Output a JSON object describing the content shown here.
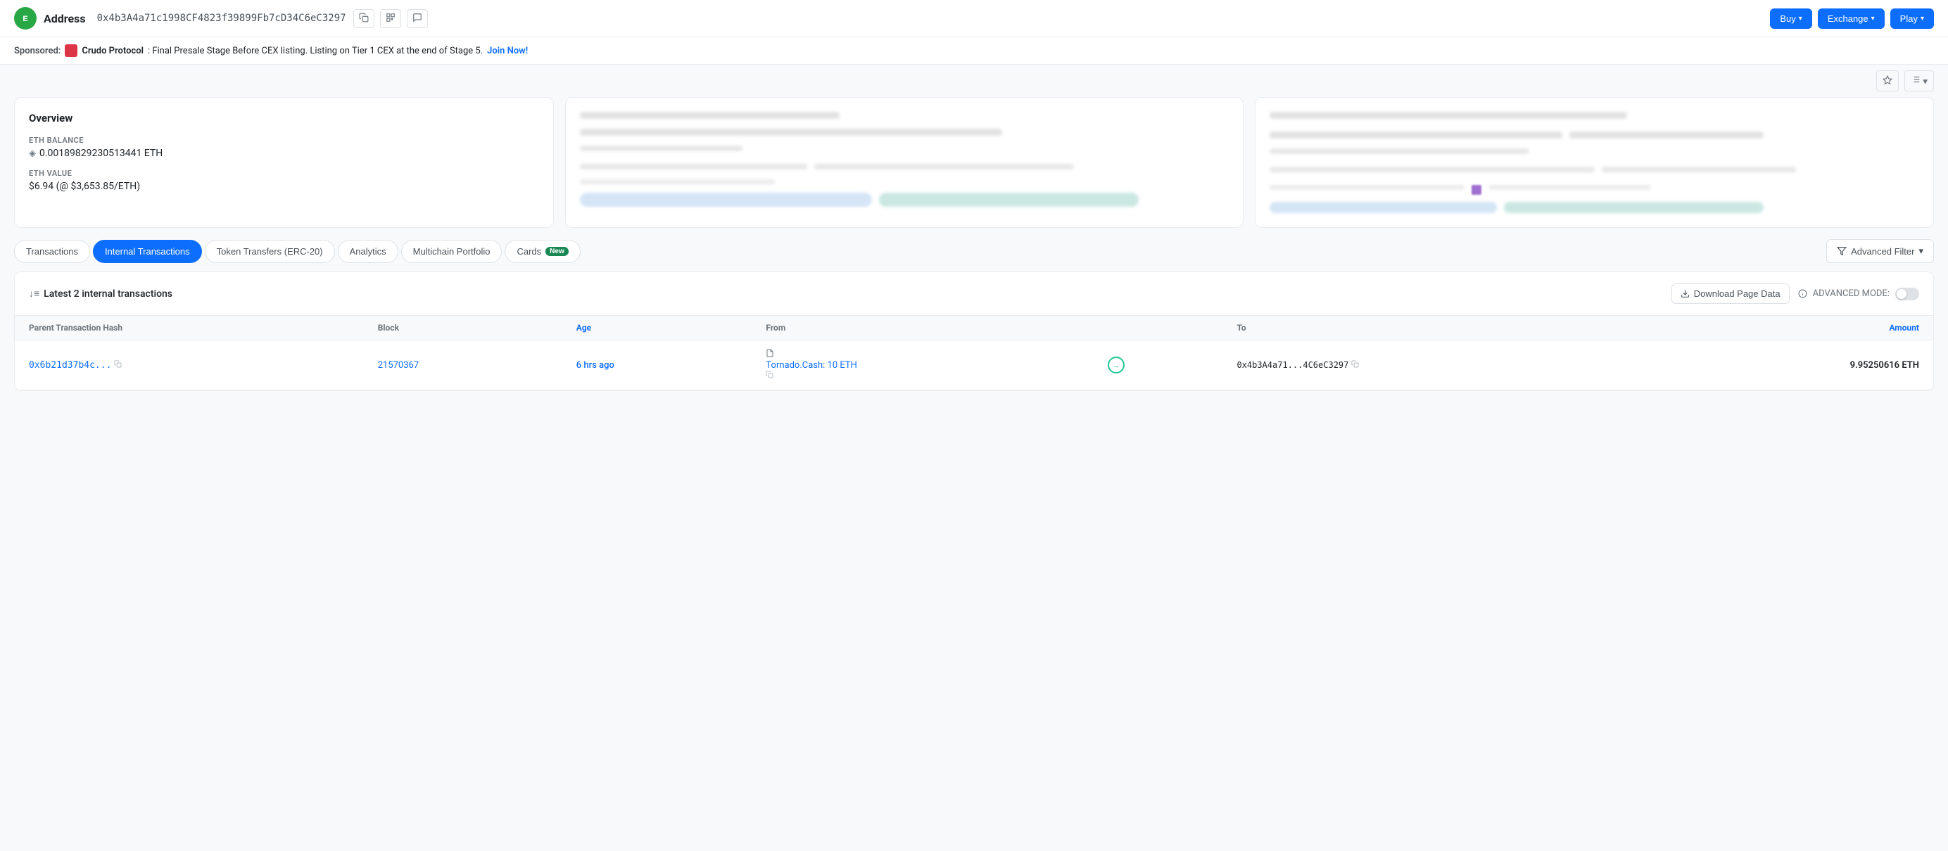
{
  "header": {
    "logo_text": "E",
    "address_label": "Address",
    "address_value": "0x4b3A4a71c1998CF4823f39899Fb7cD34C6eC3297",
    "icons": [
      "copy",
      "qr",
      "chat"
    ],
    "buttons": [
      {
        "label": "Buy",
        "key": "buy"
      },
      {
        "label": "Exchange",
        "key": "exchange"
      },
      {
        "label": "Play",
        "key": "play"
      }
    ]
  },
  "sponsored": {
    "label": "Sponsored:",
    "sponsor": "Crudo Protocol",
    "description": ": Final Presale Stage Before CEX listing. Listing on Tier 1 CEX at the end of Stage 5.",
    "cta": "Join Now!"
  },
  "overview": {
    "card1": {
      "title": "Overview",
      "eth_balance_label": "ETH BALANCE",
      "eth_balance_value": "0.00189829230513441 ETH",
      "eth_value_label": "ETH VALUE",
      "eth_value_value": "$6.94 (@ $3,653.85/ETH)"
    }
  },
  "tabs": [
    {
      "label": "Transactions",
      "key": "transactions",
      "active": false
    },
    {
      "label": "Internal Transactions",
      "key": "internal_transactions",
      "active": true
    },
    {
      "label": "Token Transfers (ERC-20)",
      "key": "token_transfers",
      "active": false
    },
    {
      "label": "Analytics",
      "key": "analytics",
      "active": false
    },
    {
      "label": "Multichain Portfolio",
      "key": "multichain",
      "active": false
    },
    {
      "label": "Cards",
      "key": "cards",
      "active": false,
      "badge": "New"
    }
  ],
  "advanced_filter_label": "Advanced Filter",
  "table": {
    "title": "Latest 2 internal transactions",
    "sort_icon": "↓≡",
    "download_label": "Download Page Data",
    "advanced_mode_label": "ADVANCED MODE:",
    "columns": [
      {
        "key": "hash",
        "label": "Parent Transaction Hash"
      },
      {
        "key": "block",
        "label": "Block"
      },
      {
        "key": "age",
        "label": "Age"
      },
      {
        "key": "from",
        "label": "From"
      },
      {
        "key": "arrow",
        "label": ""
      },
      {
        "key": "to",
        "label": "To"
      },
      {
        "key": "amount",
        "label": "Amount"
      }
    ],
    "rows": [
      {
        "hash": "0x6b21d37b4c...",
        "block": "21570367",
        "age": "6 hrs ago",
        "from": "Tornado.Cash: 10 ETH",
        "to": "0x4b3A4a71...4C6eC3297",
        "amount": "9.95250616 ETH"
      }
    ]
  }
}
